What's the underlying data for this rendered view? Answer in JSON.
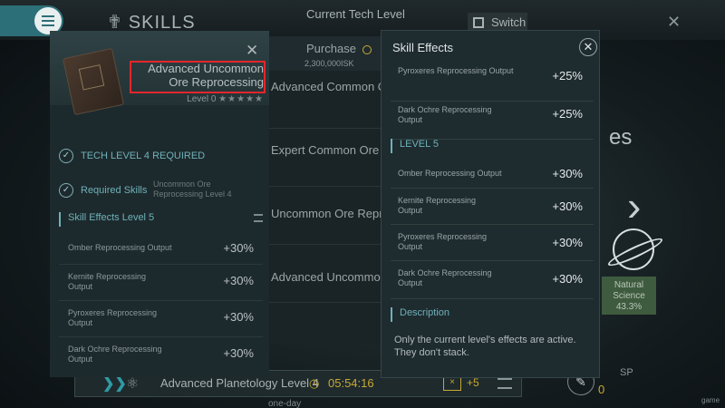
{
  "background": {
    "header_title": "SKILLS",
    "tech_level_label": "Current Tech Level",
    "switch_label": "Switch",
    "right_title_fragment": "es",
    "natural_science_label": "Natural Science",
    "natural_science_pct": "43.3%",
    "bottom_bar": {
      "skill_name": "Advanced Planetology Level 4",
      "time": "05:54:16",
      "badge": "×",
      "plus": "+5",
      "subtitle": "one-day"
    },
    "sp_label": "SP",
    "sp_value": "0",
    "watermark": "game"
  },
  "middle_list": {
    "purchase_label": "Purchase",
    "purchase_cost": "2,300,000ISK",
    "items": [
      "Advanced Common Ore",
      "Expert Common Ore Reprocessing",
      "Uncommon Ore Reprocessing",
      "Advanced Uncommon"
    ]
  },
  "skill_detail": {
    "title": "Advanced Uncommon Ore Reprocessing",
    "level": "Level 0",
    "level_stars": "★★★★★",
    "requirements": [
      {
        "label": "TECH LEVEL 4 REQUIRED",
        "sub": ""
      },
      {
        "label": "Required Skills",
        "sub": "Uncommon Ore Reprocessing Level 4"
      }
    ],
    "effects_header": "Skill Effects Level 5",
    "effects": [
      {
        "name": "Omber Reprocessing Output",
        "value": "+30%"
      },
      {
        "name": "Kernite Reprocessing Output",
        "value": "+30%"
      },
      {
        "name": "Pyroxeres Reprocessing Output",
        "value": "+30%"
      },
      {
        "name": "Dark Ochre Reprocessing Output",
        "value": "+30%"
      }
    ]
  },
  "popup": {
    "title": "Skill Effects",
    "top_rows": [
      {
        "name": "Pyroxeres Reprocessing Output",
        "value": "+25%"
      },
      {
        "name": "Dark Ochre Reprocessing Output",
        "value": "+25%"
      }
    ],
    "level5_header": "LEVEL 5",
    "level5_rows": [
      {
        "name": "Omber Reprocessing Output",
        "value": "+30%"
      },
      {
        "name": "Kernite Reprocessing Output",
        "value": "+30%"
      },
      {
        "name": "Pyroxeres Reprocessing Output",
        "value": "+30%"
      },
      {
        "name": "Dark Ochre Reprocessing Output",
        "value": "+30%"
      }
    ],
    "description_header": "Description",
    "description": "Only the current level's effects are active. They don't stack."
  },
  "colors": {
    "accent": "#6fb1b9",
    "highlight": "#e3262b",
    "gold": "#c8a933"
  }
}
